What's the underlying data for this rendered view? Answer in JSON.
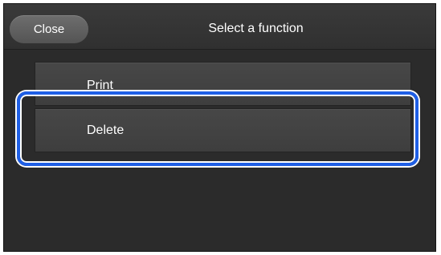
{
  "header": {
    "close_label": "Close",
    "title": "Select a function"
  },
  "menu": {
    "items": [
      {
        "label": "Print"
      },
      {
        "label": "Delete"
      }
    ]
  },
  "colors": {
    "highlight": "#1f5fe6",
    "background": "#2b2b2b"
  }
}
